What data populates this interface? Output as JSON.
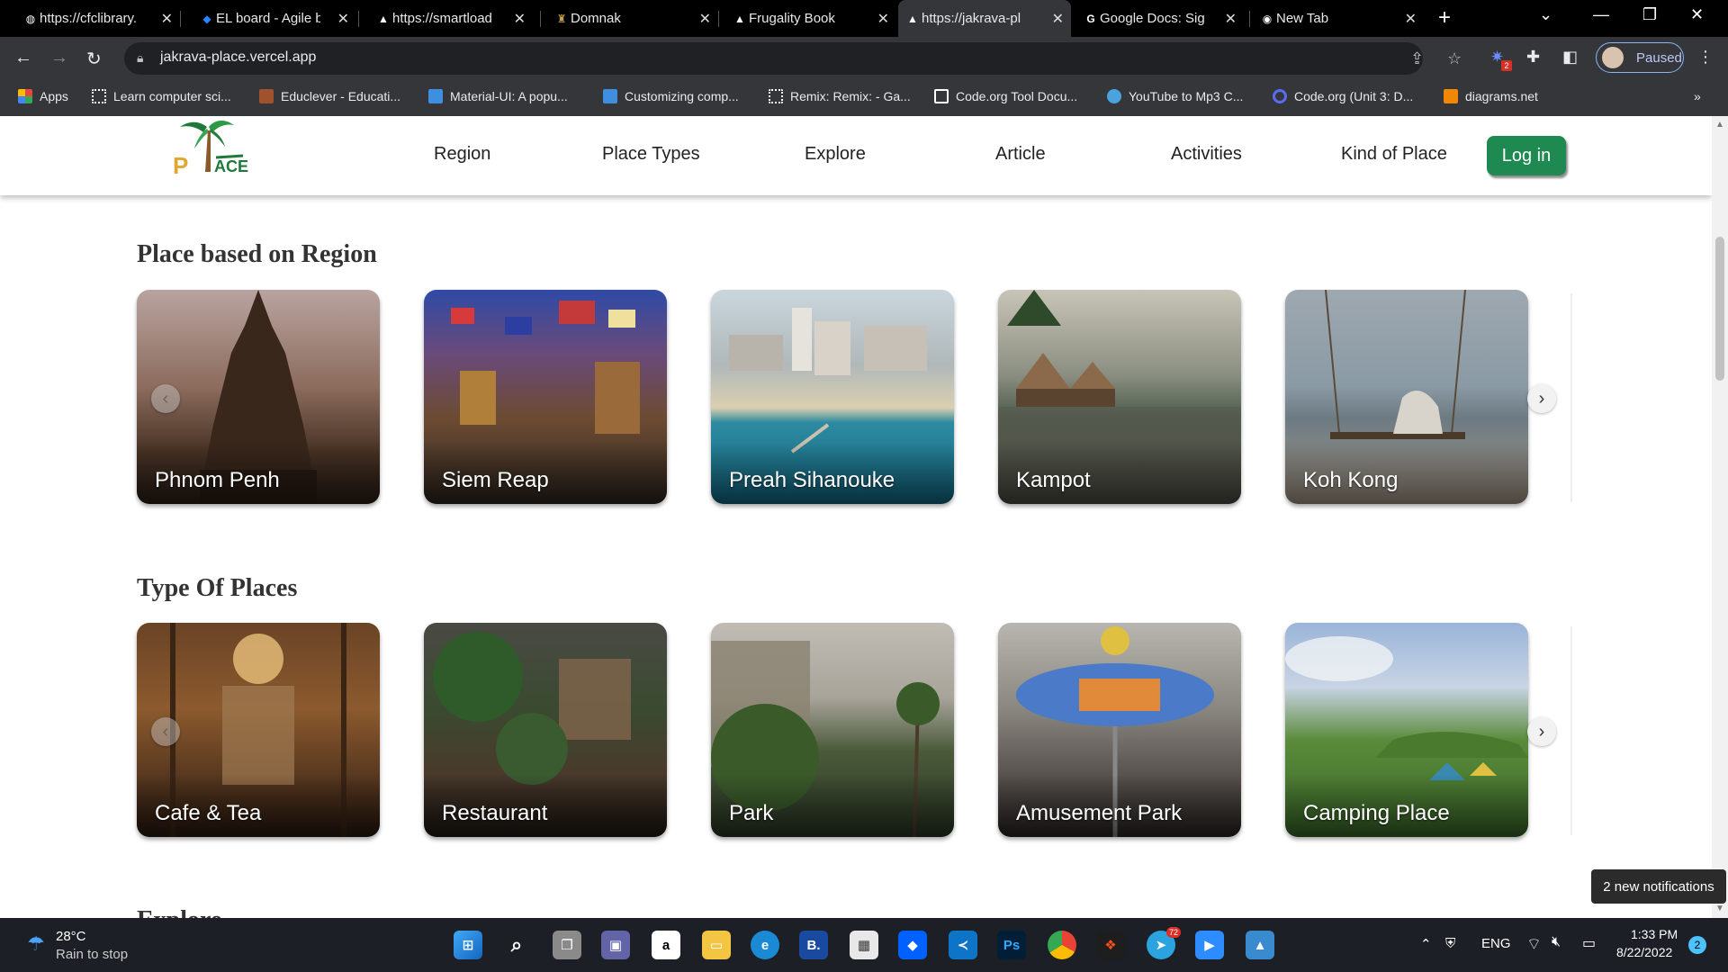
{
  "browser": {
    "tabs": [
      {
        "title": "https://cfclibrary.",
        "favicon": "globe-icon"
      },
      {
        "title": "EL board - Agile b",
        "favicon": "jira-icon"
      },
      {
        "title": "https://smartload",
        "favicon": "vercel-icon"
      },
      {
        "title": "Domnak",
        "favicon": "site-icon"
      },
      {
        "title": "Frugality Book",
        "favicon": "vercel-icon"
      },
      {
        "title": "https://jakrava-pl",
        "favicon": "vercel-icon"
      },
      {
        "title": "Google Docs: Sig",
        "favicon": "google-icon"
      },
      {
        "title": "New Tab",
        "favicon": "chrome-icon"
      }
    ],
    "url": "jakrava-place.vercel.app",
    "profile_label": "Paused",
    "extension_badge": "2",
    "bookmarks": [
      {
        "label": "Apps",
        "color": "#e8453c"
      },
      {
        "label": "Learn computer sci...",
        "color": "#ffffff"
      },
      {
        "label": "Educlever - Educati...",
        "color": "#a0522d"
      },
      {
        "label": "Material-UI: A popu...",
        "color": "#3f8fe0"
      },
      {
        "label": "Customizing comp...",
        "color": "#3f8fe0"
      },
      {
        "label": "Remix: Remix: - Ga...",
        "color": "#ffffff"
      },
      {
        "label": "Code.org Tool Docu...",
        "color": "#ffffff"
      },
      {
        "label": "YouTube to Mp3 C...",
        "color": "#4aa3df"
      },
      {
        "label": "Code.org (Unit 3: D...",
        "color": "#5b6cf0"
      },
      {
        "label": "diagrams.net",
        "color": "#f08705"
      }
    ],
    "bookmarks_more": "»"
  },
  "site": {
    "nav": [
      "Region",
      "Place Types",
      "Explore",
      "Article",
      "Activities",
      "Kind of Place"
    ],
    "login_label": "Log in",
    "accent": "#1e8a52",
    "logo_text": "PLACE",
    "sections": [
      {
        "title": "Place based on Region",
        "cards": [
          "Phnom Penh",
          "Siem Reap",
          "Preah Sihanouke",
          "Kampot",
          "Koh Kong"
        ]
      },
      {
        "title": "Type Of Places",
        "cards": [
          "Cafe & Tea",
          "Restaurant",
          "Park",
          "Amusement Park",
          "Camping Place"
        ]
      }
    ],
    "next_section_partial": "Explore"
  },
  "notification": "2 new notifications",
  "taskbar": {
    "weather_temp": "28°C",
    "weather_desc": "Rain to stop",
    "lang": "ENG",
    "time": "1:33 PM",
    "date": "8/22/2022",
    "notif_count": "2",
    "telegram_badge": "72"
  }
}
